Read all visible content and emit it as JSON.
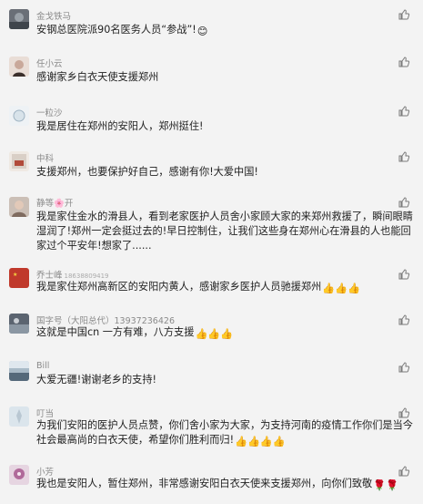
{
  "comments": [
    {
      "name": "金戈铁马",
      "text": "安钢总医院派90名医务人员“参战”!",
      "emoji": "😊",
      "avatar_color": "#6a6f77"
    },
    {
      "name": "任小云",
      "text": "感谢家乡白衣天使支援郑州",
      "emoji": "",
      "avatar_color": "#c9a89a"
    },
    {
      "name": "一粒沙",
      "text": "我是居住在郑州的安阳人，郑州挺住!",
      "emoji": "",
      "avatar_color": "#d8e3ea"
    },
    {
      "name": "中科",
      "text": "支援郑州，也要保护好自己，感谢有你!大爱中国!",
      "emoji": "",
      "avatar_color": "#d9cfc6"
    },
    {
      "name": "静等🌸开",
      "text": "我是家住金水的滑县人，看到老家医护人员舍小家顾大家的来郑州救援了，瞬间眼睛湿润了!郑州一定会挺过去的!早日控制住，让我们这些身在郑州心在滑县的人也能回家过个平安年!想家了......",
      "emoji": "",
      "avatar_color": "#7f6b5f"
    },
    {
      "name": "乔士峰",
      "name_sub": "18638809419",
      "text": "我是家住郑州高新区的安阳内黄人，感谢家乡医护人员驰援郑州",
      "emoji": "👍👍👍",
      "avatar_color": "#c0392b"
    },
    {
      "name": "国字号（大阳总代）13937236426",
      "text": "这就是中国cn 一方有难，八方支援",
      "emoji": "👍👍👍",
      "avatar_color": "#6f7d8c"
    },
    {
      "name": "Bill",
      "text": "大爱无疆!谢谢老乡的支持!",
      "emoji": "",
      "avatar_color": "#8aa1b1"
    },
    {
      "name": "叮当",
      "text": "为我们安阳的医护人员点赞，你们舍小家为大家，为支持河南的疫情工作你们是当今社会最高尚的白衣天使，希望你们胜利而归!",
      "emoji": "👍👍👍👍",
      "avatar_color": "#b9c7d2"
    },
    {
      "name": "小芳",
      "text": "我也是安阳人，暂住郑州，非常感谢安阳白衣天使来支援郑州，向你们致敬",
      "emoji": "🌹🌹",
      "avatar_color": "#b06a9a"
    }
  ],
  "colors": {
    "background": "#f3f3f3",
    "text": "#1f1f1f",
    "name": "#8a8a8a",
    "thumb": "#f0b429"
  }
}
